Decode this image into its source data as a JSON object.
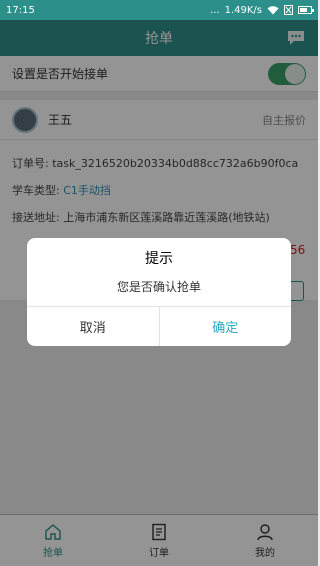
{
  "statusbar": {
    "time": "17:15",
    "dots": "...",
    "network_speed": "1.49K/s",
    "battery_level": 0.7
  },
  "header": {
    "title": "抢单",
    "message_icon": "chat-bubble-icon"
  },
  "settings": {
    "auto_accept_label": "设置是否开始接单",
    "auto_accept_on": true
  },
  "order": {
    "user_name": "王五",
    "price_mode": "自主报价",
    "order_no_label": "订单号:",
    "order_no": "task_3216520b20334b0d88cc732a6b90f0ca",
    "car_type_label": "学车类型:",
    "car_type": "C1手动挡",
    "address_label": "接送地址:",
    "address": "上海市浦东新区莲溪路靠近莲溪路(地铁站)",
    "price_peek": "56"
  },
  "dialog": {
    "title": "提示",
    "message": "您是否确认抢单",
    "cancel_label": "取消",
    "confirm_label": "确定"
  },
  "bottom_nav": {
    "items": [
      {
        "label": "抢单",
        "icon": "home-icon",
        "active": true
      },
      {
        "label": "订单",
        "icon": "list-icon",
        "active": false
      },
      {
        "label": "我的",
        "icon": "user-icon",
        "active": false
      }
    ]
  },
  "colors": {
    "primary": "#2d8f8a",
    "toggle_on": "#3aa06a",
    "link": "#2d8fb0",
    "confirm": "#2aa7c4",
    "price": "#d0211c"
  }
}
